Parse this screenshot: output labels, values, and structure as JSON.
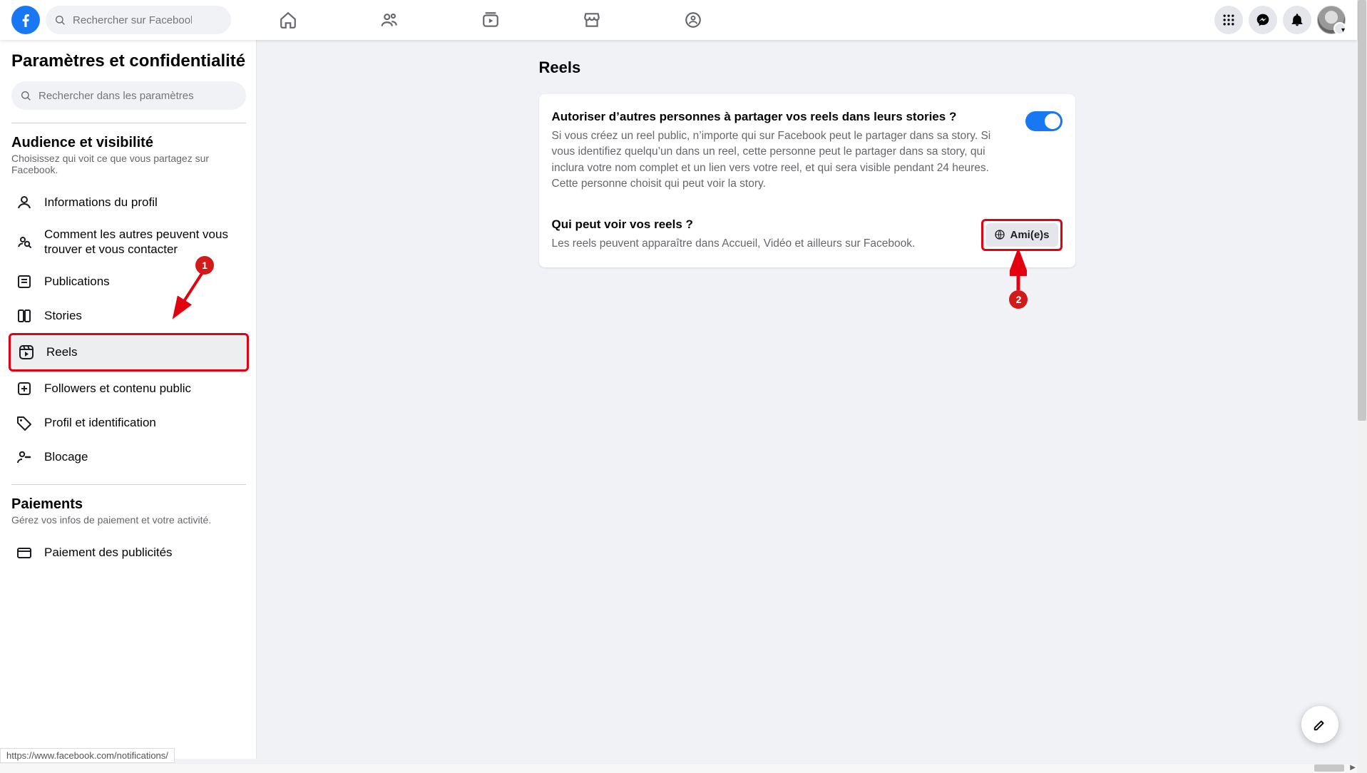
{
  "header": {
    "search_placeholder": "Rechercher sur Facebook"
  },
  "sidebar": {
    "title": "Paramètres et confidentialité",
    "search_placeholder": "Rechercher dans les paramètres",
    "section1_title": "Audience et visibilité",
    "section1_sub": "Choisissez qui voit ce que vous partagez sur Facebook.",
    "items": [
      {
        "label": "Informations du profil"
      },
      {
        "label": "Comment les autres peuvent vous trouver et vous contacter"
      },
      {
        "label": "Publications"
      },
      {
        "label": "Stories"
      },
      {
        "label": "Reels"
      },
      {
        "label": "Followers et contenu public"
      },
      {
        "label": "Profil et identification"
      },
      {
        "label": "Blocage"
      }
    ],
    "section2_title": "Paiements",
    "section2_sub": "Gérez vos infos de paiement et votre activité.",
    "pay_items": [
      {
        "label": "Paiement des publicités"
      }
    ]
  },
  "main": {
    "title": "Reels",
    "row1_title": "Autoriser d’autres personnes à partager vos reels dans leurs stories ?",
    "row1_desc": "Si vous créez un reel public, n’importe qui sur Facebook peut le partager dans sa story. Si vous identifiez quelqu’un dans un reel, cette personne peut le partager dans sa story, qui inclura votre nom complet et un lien vers votre reel, et qui sera visible pendant 24 heures. Cette personne choisit qui peut voir la story.",
    "row2_title": "Qui peut voir vos reels ?",
    "row2_desc": "Les reels peuvent apparaître dans Accueil, Vidéo et ailleurs sur Facebook.",
    "audience_label": "Ami(e)s"
  },
  "annotations": {
    "badge1": "1",
    "badge2": "2"
  },
  "status_url": "https://www.facebook.com/notifications/"
}
